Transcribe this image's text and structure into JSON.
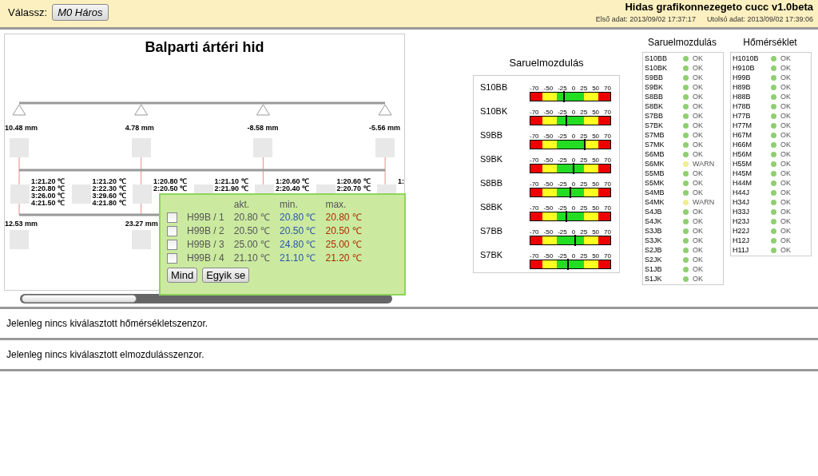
{
  "header": {
    "select_label": "Válassz:",
    "select_button": "M0 Háros",
    "title": "Hidas grafikonnezegeto cucc v1.0beta",
    "first_data": "Első adat: 2013/09/02 17:37:17",
    "last_data": "Utolsó adat: 2013/09/02 17:39:06"
  },
  "bridge": {
    "title": "Balparti ártéri hid",
    "top_readings": [
      "10.48 mm",
      "4.78 mm",
      "-8.58 mm",
      "-5.56 mm"
    ],
    "temp_groups": [
      {
        "lines": [
          "1:21.20 ℃",
          "2:20.80 ℃",
          "3:26.00 ℃",
          "4:21.50 ℃"
        ]
      },
      {
        "lines": [
          "1:21.20 ℃",
          "2:22.30 ℃",
          "3:29.60 ℃",
          "4:21.80 ℃"
        ]
      },
      {
        "lines": [
          "1:20.80 ℃",
          "2:20.50 ℃"
        ]
      },
      {
        "lines": [
          "1:21.10 ℃",
          "2:21.90 ℃"
        ]
      },
      {
        "lines": [
          "1:20.60 ℃",
          "2:20.40 ℃"
        ]
      },
      {
        "lines": [
          "1:20.60 ℃",
          "2:20.70 ℃"
        ]
      },
      {
        "lines": [
          "1:"
        ]
      }
    ],
    "bottom_readings": [
      "12.53 mm",
      "23.27 mm"
    ]
  },
  "popup": {
    "headers": [
      "akt.",
      "min.",
      "max."
    ],
    "rows": [
      {
        "name": "H99B / 1",
        "checked": false,
        "akt": "20.80 ℃",
        "min": "20.80 ℃",
        "max": "20.80 ℃"
      },
      {
        "name": "H99B / 2",
        "checked": false,
        "akt": "20.50 ℃",
        "min": "20.50 ℃",
        "max": "20.50 ℃"
      },
      {
        "name": "H99B / 3",
        "checked": false,
        "akt": "25.00 ℃",
        "min": "24.80 ℃",
        "max": "25.00 ℃"
      },
      {
        "name": "H99B / 4",
        "checked": false,
        "akt": "21.10 ℃",
        "min": "21.10 ℃",
        "max": "21.20 ℃"
      }
    ],
    "buttons": [
      "Mind",
      "Egyik se"
    ]
  },
  "gauges": {
    "title": "Saruelmozdulás",
    "rows": [
      {
        "name": "S10BB",
        "scale": [
          "-70",
          "-50",
          "-25",
          "0",
          "25",
          "50",
          "70"
        ],
        "level": 0.42
      },
      {
        "name": "S10BK",
        "scale": [
          "-70",
          "-50",
          "-25",
          "0",
          "25",
          "50",
          "70"
        ],
        "level": 0.45
      },
      {
        "name": "S9BB",
        "scale": [
          "-70",
          "-50",
          "-25",
          "0",
          "25",
          "50",
          "70"
        ],
        "level": 0.68
      },
      {
        "name": "S9BK",
        "scale": [
          "-70",
          "-50",
          "-25",
          "0",
          "25",
          "50",
          "70"
        ],
        "level": 0.54
      },
      {
        "name": "S8BB",
        "scale": [
          "-70",
          "-50",
          "-25",
          "0",
          "25",
          "50",
          "70"
        ],
        "level": 0.5
      },
      {
        "name": "S8BK",
        "scale": [
          "-70",
          "-50",
          "-25",
          "0",
          "25",
          "50",
          "70"
        ],
        "level": 0.45
      },
      {
        "name": "S7BB",
        "scale": [
          "-70",
          "-50",
          "-25",
          "0",
          "25",
          "50",
          "70"
        ],
        "level": 0.56
      },
      {
        "name": "S7BK",
        "scale": [
          "-70",
          "-50",
          "-25",
          "0",
          "25",
          "50",
          "70"
        ],
        "level": 0.47
      }
    ]
  },
  "lists": [
    {
      "title": "Saruelmozdulás",
      "items": [
        {
          "name": "S10BB",
          "status": "OK",
          "color": "#8fcf70"
        },
        {
          "name": "S10BK",
          "status": "OK",
          "color": "#8fcf70"
        },
        {
          "name": "S9BB",
          "status": "OK",
          "color": "#8fcf70"
        },
        {
          "name": "S9BK",
          "status": "OK",
          "color": "#8fcf70"
        },
        {
          "name": "S8BB",
          "status": "OK",
          "color": "#8fcf70"
        },
        {
          "name": "S8BK",
          "status": "OK",
          "color": "#8fcf70"
        },
        {
          "name": "S7BB",
          "status": "OK",
          "color": "#8fcf70"
        },
        {
          "name": "S7BK",
          "status": "OK",
          "color": "#8fcf70"
        },
        {
          "name": "S7MB",
          "status": "OK",
          "color": "#8fcf70"
        },
        {
          "name": "S7MK",
          "status": "OK",
          "color": "#8fcf70"
        },
        {
          "name": "S6MB",
          "status": "OK",
          "color": "#8fcf70"
        },
        {
          "name": "S6MK",
          "status": "WARN",
          "color": "#f0ee90"
        },
        {
          "name": "S5MB",
          "status": "OK",
          "color": "#8fcf70"
        },
        {
          "name": "S5MK",
          "status": "OK",
          "color": "#8fcf70"
        },
        {
          "name": "S4MB",
          "status": "OK",
          "color": "#8fcf70"
        },
        {
          "name": "S4MK",
          "status": "WARN",
          "color": "#f0ee90"
        },
        {
          "name": "S4JB",
          "status": "OK",
          "color": "#8fcf70"
        },
        {
          "name": "S4JK",
          "status": "OK",
          "color": "#8fcf70"
        },
        {
          "name": "S3JB",
          "status": "OK",
          "color": "#8fcf70"
        },
        {
          "name": "S3JK",
          "status": "OK",
          "color": "#8fcf70"
        },
        {
          "name": "S2JB",
          "status": "OK",
          "color": "#8fcf70"
        },
        {
          "name": "S2JK",
          "status": "OK",
          "color": "#8fcf70"
        },
        {
          "name": "S1JB",
          "status": "OK",
          "color": "#8fcf70"
        },
        {
          "name": "S1JK",
          "status": "OK",
          "color": "#8fcf70"
        }
      ]
    },
    {
      "title": "Hőmérséklet",
      "items": [
        {
          "name": "H1010B",
          "status": "OK",
          "color": "#8fcf70"
        },
        {
          "name": "H910B",
          "status": "OK",
          "color": "#8fcf70"
        },
        {
          "name": "H99B",
          "status": "OK",
          "color": "#8fcf70"
        },
        {
          "name": "H89B",
          "status": "OK",
          "color": "#8fcf70"
        },
        {
          "name": "H88B",
          "status": "OK",
          "color": "#8fcf70"
        },
        {
          "name": "H78B",
          "status": "OK",
          "color": "#8fcf70"
        },
        {
          "name": "H77B",
          "status": "OK",
          "color": "#8fcf70"
        },
        {
          "name": "H77M",
          "status": "OK",
          "color": "#8fcf70"
        },
        {
          "name": "H67M",
          "status": "OK",
          "color": "#8fcf70"
        },
        {
          "name": "H66M",
          "status": "OK",
          "color": "#8fcf70"
        },
        {
          "name": "H56M",
          "status": "OK",
          "color": "#8fcf70"
        },
        {
          "name": "H55M",
          "status": "OK",
          "color": "#8fcf70"
        },
        {
          "name": "H45M",
          "status": "OK",
          "color": "#8fcf70"
        },
        {
          "name": "H44M",
          "status": "OK",
          "color": "#8fcf70"
        },
        {
          "name": "H44J",
          "status": "OK",
          "color": "#8fcf70"
        },
        {
          "name": "H34J",
          "status": "OK",
          "color": "#8fcf70"
        },
        {
          "name": "H33J",
          "status": "OK",
          "color": "#8fcf70"
        },
        {
          "name": "H23J",
          "status": "OK",
          "color": "#8fcf70"
        },
        {
          "name": "H22J",
          "status": "OK",
          "color": "#8fcf70"
        },
        {
          "name": "H12J",
          "status": "OK",
          "color": "#8fcf70"
        },
        {
          "name": "H11J",
          "status": "OK",
          "color": "#8fcf70"
        }
      ]
    }
  ],
  "messages": [
    "Jelenleg nincs kiválasztott hőmérsékletszenzor.",
    "Jelenleg nincs kiválasztott elmozdulásszenzor."
  ]
}
